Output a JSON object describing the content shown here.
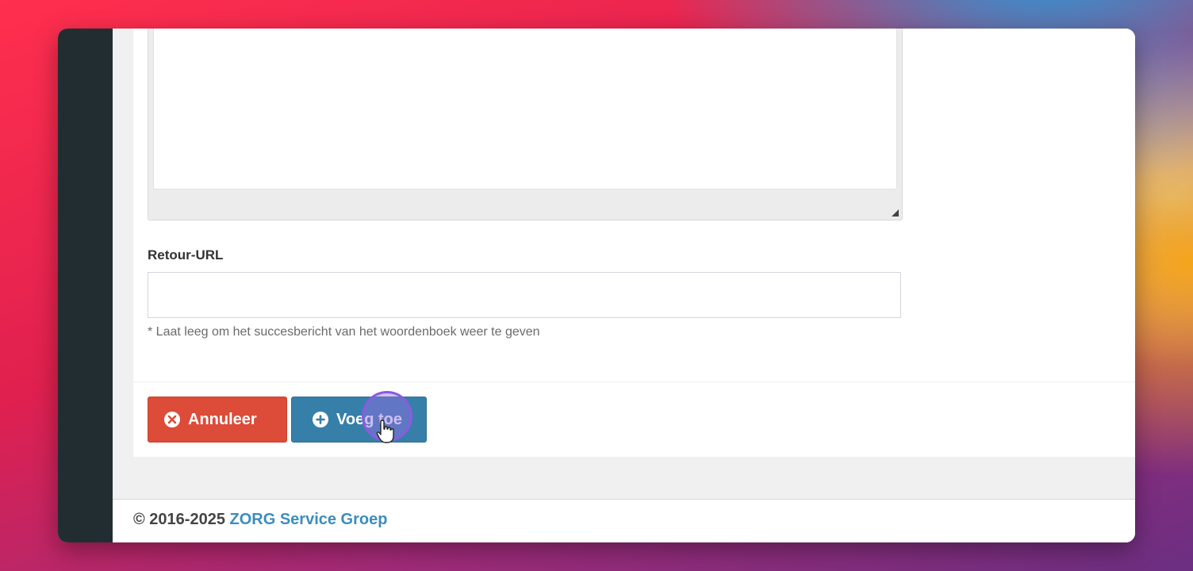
{
  "form": {
    "return_url_label": "Retour-URL",
    "return_url_value": "",
    "return_url_help": "* Laat leeg om het succesbericht van het woordenboek weer te geven"
  },
  "actions": {
    "cancel_label": "Annuleer",
    "add_label": "Voeg toe"
  },
  "footer": {
    "copyright": "© 2016-2025",
    "company": "ZORG Service Groep"
  },
  "colors": {
    "cancel": "#dd4b39",
    "add": "#367fa9",
    "sidebar": "#222d32",
    "link": "#3c8dbc"
  }
}
